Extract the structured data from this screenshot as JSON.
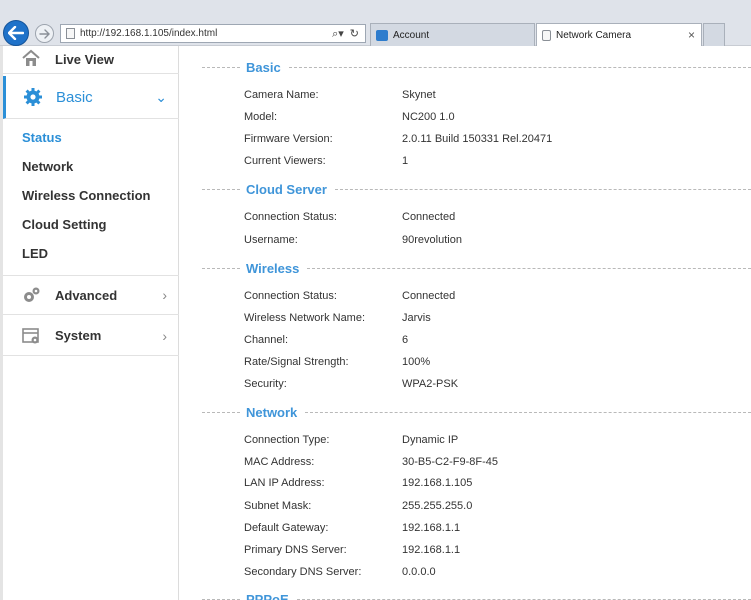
{
  "browser": {
    "url": "http://192.168.1.105/index.html",
    "tabs": [
      {
        "label": "Account"
      },
      {
        "label": "Network Camera"
      }
    ],
    "close_glyph": "×"
  },
  "sidebar": {
    "live_view": "Live View",
    "basic": "Basic",
    "basic_items": [
      "Status",
      "Network",
      "Wireless Connection",
      "Cloud Setting",
      "LED"
    ],
    "advanced": "Advanced",
    "system": "System",
    "chevron_down": "⌄",
    "chevron_right": "›",
    "accent": "#2b8fd7"
  },
  "sections": [
    {
      "title": "Basic",
      "rows": [
        {
          "label": "Camera Name:",
          "value": "Skynet"
        },
        {
          "label": "Model:",
          "value": "NC200 1.0"
        },
        {
          "label": "Firmware Version:",
          "value": "2.0.11 Build 150331 Rel.20471"
        },
        {
          "label": "Current Viewers:",
          "value": "1"
        }
      ]
    },
    {
      "title": "Cloud Server",
      "rows": [
        {
          "label": "Connection Status:",
          "value": "Connected"
        },
        {
          "label": "Username:",
          "value": "90revolution"
        }
      ]
    },
    {
      "title": "Wireless",
      "rows": [
        {
          "label": "Connection Status:",
          "value": "Connected"
        },
        {
          "label": "Wireless Network Name:",
          "value": "Jarvis"
        },
        {
          "label": "Channel:",
          "value": "6"
        },
        {
          "label": "Rate/Signal Strength:",
          "value": "100%"
        },
        {
          "label": "Security:",
          "value": "WPA2-PSK"
        }
      ]
    },
    {
      "title": "Network",
      "rows": [
        {
          "label": "Connection Type:",
          "value": "Dynamic IP"
        },
        {
          "label": "MAC Address:",
          "value": "30-B5-C2-F9-8F-45"
        },
        {
          "label": "LAN IP Address:",
          "value": "192.168.1.105"
        },
        {
          "label": "Subnet Mask:",
          "value": "255.255.255.0"
        },
        {
          "label": "Default Gateway:",
          "value": "192.168.1.1"
        },
        {
          "label": "Primary DNS Server:",
          "value": "192.168.1.1"
        },
        {
          "label": "Secondary DNS Server:",
          "value": "0.0.0.0"
        }
      ]
    },
    {
      "title": "PPPoE",
      "rows": []
    }
  ]
}
